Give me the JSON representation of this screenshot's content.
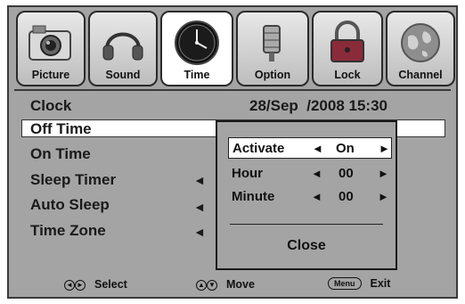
{
  "tabs": [
    {
      "label": "Picture",
      "icon": "camera-icon"
    },
    {
      "label": "Sound",
      "icon": "headphones-icon"
    },
    {
      "label": "Time",
      "icon": "clock-icon"
    },
    {
      "label": "Option",
      "icon": "option-icon"
    },
    {
      "label": "Lock",
      "icon": "lock-icon"
    },
    {
      "label": "Channel",
      "icon": "globe-icon"
    }
  ],
  "active_tab": "Time",
  "menu": {
    "clock_label": "Clock",
    "clock_value": "28/Sep  /2008 15:30",
    "off_time_label": "Off Time",
    "on_time_label": "On Time",
    "sleep_timer_label": "Sleep Timer",
    "auto_sleep_label": "Auto Sleep",
    "time_zone_label": "Time Zone",
    "left_arrow": "◄"
  },
  "popup": {
    "rows": [
      {
        "label": "Activate",
        "value": "On",
        "left": "◄",
        "right": "►"
      },
      {
        "label": "Hour",
        "value": "00",
        "left": "◄",
        "right": "►"
      },
      {
        "label": "Minute",
        "value": "00",
        "left": "◄",
        "right": "►"
      }
    ],
    "close_label": "Close"
  },
  "footer": {
    "select_label": "Select",
    "move_label": "Move",
    "menu_key": "Menu",
    "exit_label": "Exit"
  },
  "colors": {
    "panel": "#a4a4a4",
    "frame": "#3a3a3a",
    "highlight": "#ffffff"
  }
}
